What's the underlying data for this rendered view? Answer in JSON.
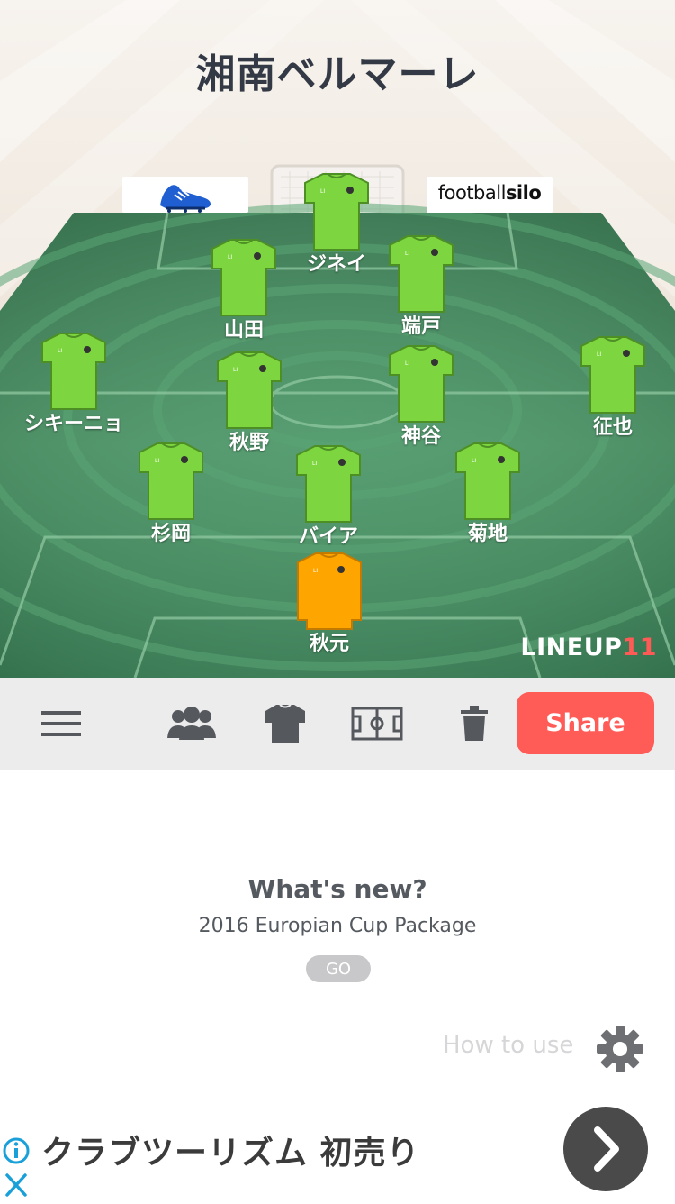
{
  "header": {
    "team_name": "湘南ベルマーレ"
  },
  "ad_boards": {
    "right_brand_regular": "football",
    "right_brand_bold": "silo",
    "left_icon": "blue-boot-icon"
  },
  "players": {
    "gk": "ジネイ",
    "p1": "山田",
    "p2": "端戸",
    "p3": "シキーニョ",
    "p4": "秋野",
    "p5": "神谷",
    "p6": "征也",
    "p7": "杉岡",
    "p8": "バイア",
    "p9": "菊地",
    "p10": "秋元"
  },
  "brand": {
    "text": "LINEUP",
    "number": "11"
  },
  "toolbar": {
    "menu_icon": "hamburger-icon",
    "players_icon": "group-icon",
    "kit_icon": "shirt-icon",
    "field_icon": "field-icon",
    "delete_icon": "trash-icon",
    "share_label": "Share"
  },
  "whatsnew": {
    "title": "What's new?",
    "subtitle": "2016 Europian Cup Package",
    "go_label": "GO"
  },
  "help": {
    "label": "How to use",
    "icon": "gear-icon"
  },
  "ad": {
    "text": "クラブツーリズム 初売り",
    "info_icon": "info-icon",
    "close_icon": "close-icon",
    "arrow_icon": "chevron-right-icon"
  },
  "colors": {
    "kit": "#7dd63f",
    "gk_kit": "#ffa500",
    "share": "#ff5b57",
    "pitch": "#3e8a5d"
  }
}
